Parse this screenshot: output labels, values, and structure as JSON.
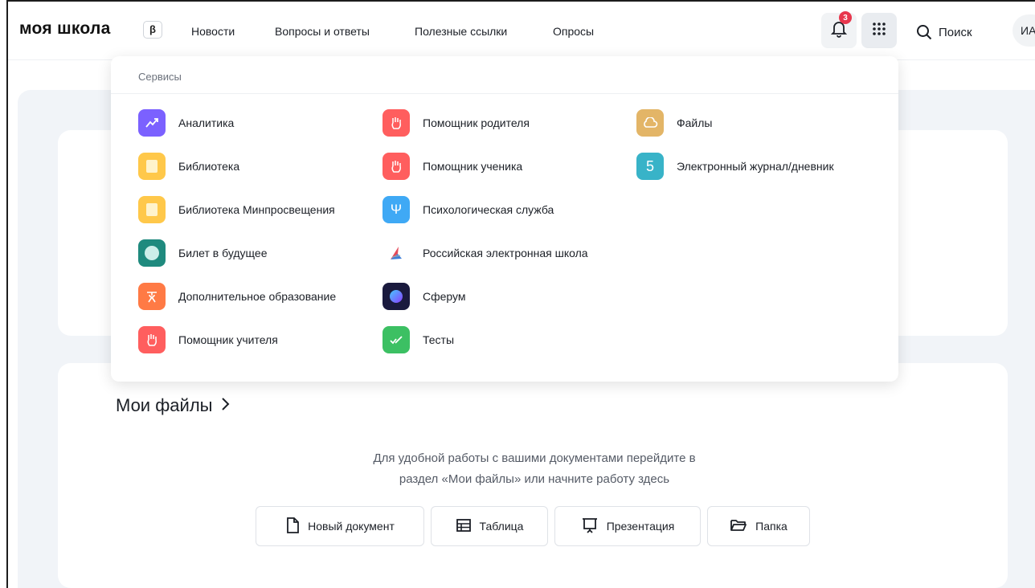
{
  "header": {
    "logo": "моя школа",
    "beta": "β",
    "nav": [
      "Новости",
      "Вопросы и ответы",
      "Полезные ссылки",
      "Опросы"
    ],
    "notifications_count": "3",
    "search_label": "Поиск",
    "avatar_initials": "ИА"
  },
  "services": {
    "title": "Сервисы",
    "items": [
      {
        "label": "Аналитика",
        "icon": "chart-icon",
        "color": "#7b61ff"
      },
      {
        "label": "Библиотека",
        "icon": "book-icon",
        "color": "#ffc84a"
      },
      {
        "label": "Библиотека Минпросвещения",
        "icon": "book-icon",
        "color": "#ffc84a"
      },
      {
        "label": "Билет в будущее",
        "icon": "globe-icon",
        "color": "#1f8a7e"
      },
      {
        "label": "Дополнительное образование",
        "icon": "teacher-icon",
        "color": "#ff7a45"
      },
      {
        "label": "Помощник учителя",
        "icon": "hand-icon",
        "color": "#ff5e5e"
      },
      {
        "label": "Помощник родителя",
        "icon": "hand-icon",
        "color": "#ff5e5e"
      },
      {
        "label": "Помощник ученика",
        "icon": "hand-icon",
        "color": "#ff5e5e"
      },
      {
        "label": "Психологическая служба",
        "icon": "psi-icon",
        "color": "#3fa9f5"
      },
      {
        "label": "Российская электронная школа",
        "icon": "resh-icon",
        "color": "#ffffff"
      },
      {
        "label": "Сферум",
        "icon": "sferum-icon",
        "color": "#1a1a3e"
      },
      {
        "label": "Тесты",
        "icon": "check-icon",
        "color": "#3cc063"
      },
      {
        "label": "Файлы",
        "icon": "cloud-icon",
        "color": "#e3b567"
      },
      {
        "label": "Электронный журнал/дневник",
        "icon": "grade-five-icon",
        "color": "#38b3c8"
      }
    ]
  },
  "files": {
    "title": "Мои файлы",
    "description_line1": "Для удобной работы с вашими документами перейдите в",
    "description_line2": "раздел «Мои файлы» или начните работу здесь",
    "buttons": [
      "Новый документ",
      "Таблица",
      "Презентация",
      "Папка"
    ]
  }
}
